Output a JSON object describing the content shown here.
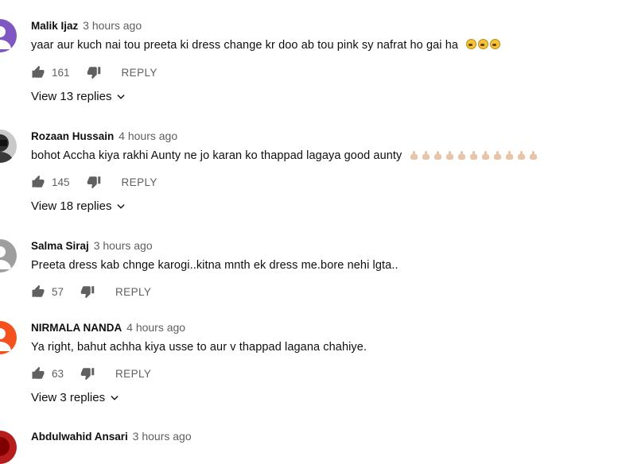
{
  "comments": [
    {
      "author": "Malik Ijaz",
      "time": "3 hours ago",
      "text": "yaar aur kuch nai tou preeta ki dress change kr doo ab tou pink sy nafrat ho gai ha",
      "likes": "161",
      "reply": "REPLY",
      "view_replies": "View 13 replies",
      "avatar_color": "#7e57c2",
      "emoji": [
        "tired-face-emoji",
        "tired-face-emoji",
        "tired-face-emoji"
      ]
    },
    {
      "author": "Rozaan Hussain",
      "time": "4 hours ago",
      "text": "bohot Accha kiya rakhi Aunty ne jo karan ko thappad lagaya good aunty",
      "likes": "145",
      "reply": "REPLY",
      "view_replies": "View 18 replies",
      "avatar_color": "#3a3a3a"
    },
    {
      "author": "Salma Siraj",
      "time": "3 hours ago",
      "text": "Preeta dress kab chnge karogi..kitna mnth ek dress me.bore nehi lgta..",
      "likes": "57",
      "reply": "REPLY",
      "avatar_color": "#9e9e9e"
    },
    {
      "author": "NIRMALA NANDA",
      "time": "4 hours ago",
      "text": "Ya right, bahut achha kiya usse to aur v thappad lagana chahiye.",
      "likes": "63",
      "reply": "REPLY",
      "view_replies": "View 3 replies",
      "avatar_color": "#f4511e"
    },
    {
      "author": "Abdulwahid Ansari",
      "time": "3 hours ago",
      "avatar_color": "#b71c1c"
    }
  ],
  "colors": {
    "secondary_text": "#606060",
    "primary_text": "#0f0f0f",
    "emoji_skin": "#e8c4a8"
  }
}
